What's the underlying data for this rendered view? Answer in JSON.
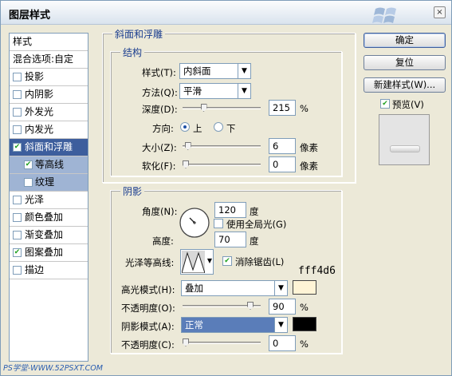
{
  "window": {
    "title": "图层样式",
    "close_glyph": "×"
  },
  "style_list": {
    "header": "样式",
    "blend_options": "混合选项:自定",
    "items": [
      {
        "label": "投影",
        "checked": false
      },
      {
        "label": "内阴影",
        "checked": false
      },
      {
        "label": "外发光",
        "checked": false
      },
      {
        "label": "内发光",
        "checked": false
      },
      {
        "label": "斜面和浮雕",
        "checked": true,
        "selected": true
      },
      {
        "label": "等高线",
        "checked": true,
        "sub": true
      },
      {
        "label": "纹理",
        "checked": false,
        "sub": true
      },
      {
        "label": "光泽",
        "checked": false
      },
      {
        "label": "颜色叠加",
        "checked": false
      },
      {
        "label": "渐变叠加",
        "checked": false
      },
      {
        "label": "图案叠加",
        "checked": true
      },
      {
        "label": "描边",
        "checked": false
      }
    ]
  },
  "bevel": {
    "section_title": "斜面和浮雕",
    "structure_title": "结构",
    "style_label": "样式(T):",
    "style_value": "内斜面",
    "technique_label": "方法(Q):",
    "technique_value": "平滑",
    "depth_label": "深度(D):",
    "depth_value": "215",
    "depth_unit": "%",
    "depth_level": 0.25,
    "direction_label": "方向:",
    "dir_up": "上",
    "dir_down": "下",
    "size_label": "大小(Z):",
    "size_value": "6",
    "size_unit": "像素",
    "size_level": 0.03,
    "soften_label": "软化(F):",
    "soften_value": "0",
    "soften_unit": "像素",
    "soften_level": 0
  },
  "shading": {
    "title": "阴影",
    "angle_label": "角度(N):",
    "angle_value": "120",
    "angle_unit": "度",
    "global_light_label": "使用全局光(G)",
    "altitude_label": "高度:",
    "altitude_value": "70",
    "altitude_unit": "度",
    "gloss_label": "光泽等高线:",
    "antialias_label": "消除锯齿(L)",
    "highlight_label": "高光模式(H):",
    "highlight_value": "叠加",
    "highlight_color": "#fff4d6",
    "highlight_opacity_label": "不透明度(O):",
    "highlight_opacity_value": "90",
    "highlight_opacity_unit": "%",
    "highlight_opacity_level": 0.9,
    "shadow_label": "阴影模式(A):",
    "shadow_value": "正常",
    "shadow_color": "#000000",
    "shadow_opacity_label": "不透明度(C):",
    "shadow_opacity_value": "0",
    "shadow_opacity_unit": "%",
    "shadow_opacity_level": 0
  },
  "annotation": "fff4d6",
  "buttons": {
    "ok": "确定",
    "reset": "复位",
    "new_style": "新建样式(W)...",
    "preview": "预览(V)"
  },
  "watermark": "PS学堂-WWW.52PSXT.COM"
}
